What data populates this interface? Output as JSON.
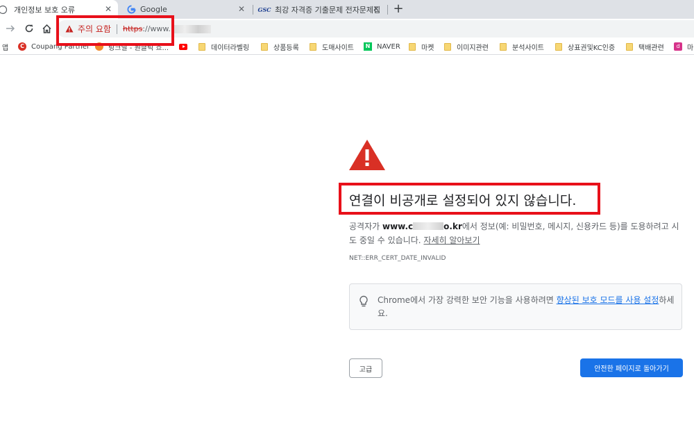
{
  "tabs": [
    {
      "title": "개인정보 보호 오류",
      "favicon": "info-circle-icon",
      "active": true
    },
    {
      "title": "Google",
      "favicon": "google-g-icon",
      "active": false
    },
    {
      "title": "최강 자격증 기출문제 전자문제집",
      "favicon": "gsc-logo-icon",
      "favicon_text": "GSC",
      "active": false
    }
  ],
  "tab_close_glyph": "✕",
  "new_tab_glyph": "+",
  "toolbar": {
    "back": "arrow-right-icon",
    "reload": "reload-icon",
    "home": "home-icon"
  },
  "omnibox": {
    "warning_label": "주의 요함",
    "url_scheme": "https",
    "url_rest": "://www."
  },
  "bookmarks": [
    {
      "label": "앱",
      "icon": "apps-icon"
    },
    {
      "label": "Coupang Partners",
      "icon": "coupang-icon",
      "icon_text": "C"
    },
    {
      "label": "링크딜 - 원클릭 쇼...",
      "icon": "orange-circle-icon"
    },
    {
      "label": "",
      "icon": "youtube-icon"
    },
    {
      "label": "데이터라벨링",
      "icon": "folder-icon"
    },
    {
      "label": "상품등록",
      "icon": "folder-icon"
    },
    {
      "label": "도매사이트",
      "icon": "folder-icon"
    },
    {
      "label": "NAVER",
      "icon": "naver-icon",
      "icon_text": "N"
    },
    {
      "label": "마켓",
      "icon": "folder-icon"
    },
    {
      "label": "이미지관련",
      "icon": "folder-icon"
    },
    {
      "label": "분석사이트",
      "icon": "folder-icon"
    },
    {
      "label": "상표권및KC인증",
      "icon": "folder-icon"
    },
    {
      "label": "택배관련",
      "icon": "folder-icon"
    },
    {
      "label": "마",
      "icon": "pink-app-icon",
      "icon_text": "d"
    }
  ],
  "interstitial": {
    "headline": "연결이 비공개로 설정되어 있지 않습니다.",
    "desc_prefix": "공격자가 ",
    "domain_start": "www.c",
    "domain_end": "o.kr",
    "desc_suffix": "에서 정보(예: 비밀번호, 메시지, 신용카드 등)를 도용하려고 시도 중일 수 있습니다. ",
    "learn_more": "자세히 알아보기",
    "error_code": "NET::ERR_CERT_DATE_INVALID",
    "info_prefix": "Chrome에서 가장 강력한 보안 기능을 사용하려면 ",
    "info_link": "향상된 보호 모드를 사용 설정",
    "info_suffix": "하세요.",
    "advanced_button": "고급",
    "back_button": "안전한 페이지로 돌아가기"
  },
  "colors": {
    "warning_red": "#d93025",
    "annotation_red": "#e8101a",
    "primary_blue": "#1a73e8"
  }
}
